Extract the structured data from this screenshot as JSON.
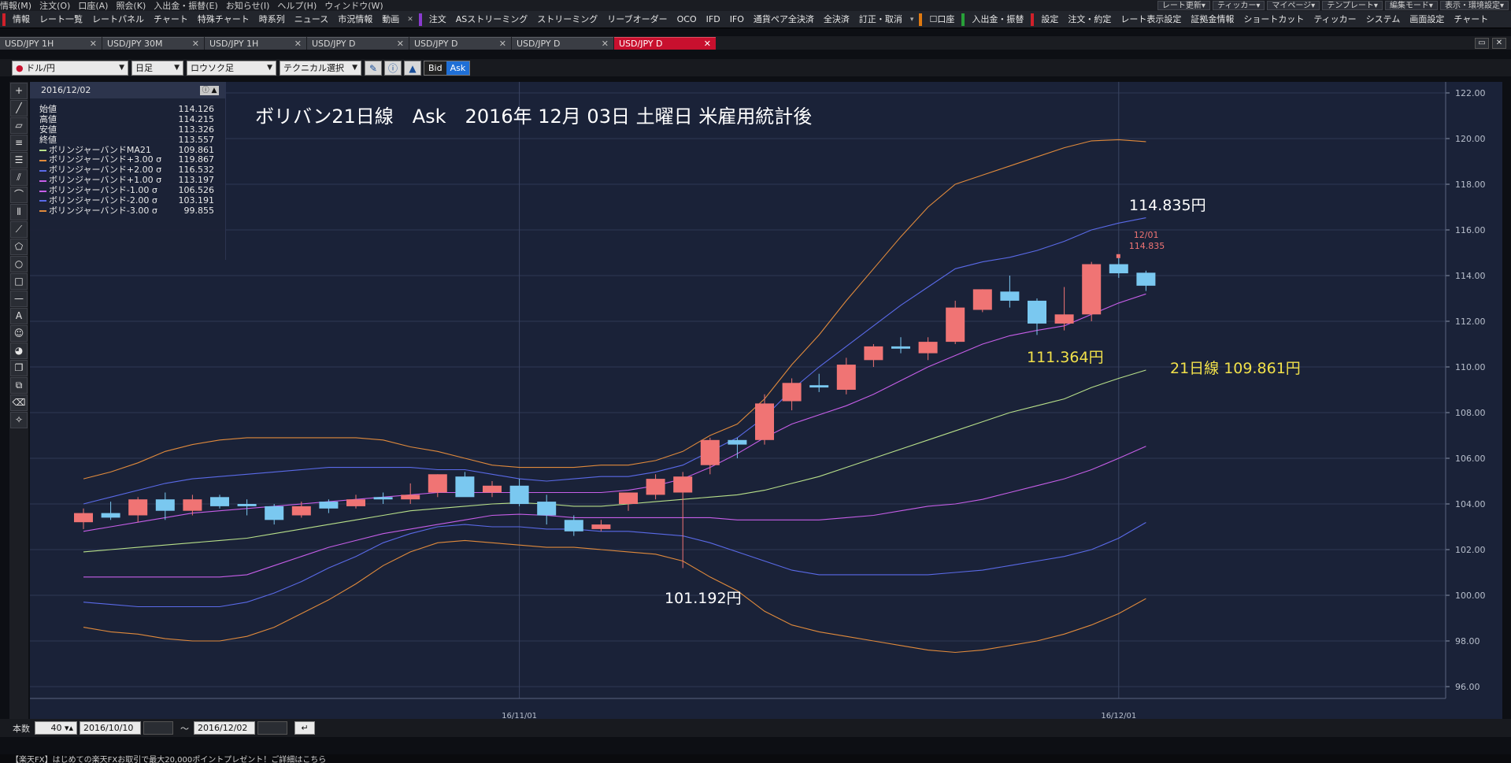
{
  "menubar": {
    "items": [
      "情報(M)",
      "注文(O)",
      "口座(A)",
      "照会(K)",
      "入出金・振替(E)",
      "お知らせ(I)",
      "ヘルプ(H)",
      "ウィンドウ(W)"
    ],
    "right_buttons": [
      "レート更新▾",
      "ティッカー▾",
      "マイページ▾",
      "テンプレート▾",
      "編集モード▾",
      "表示・環境設定▾"
    ]
  },
  "toolbar": {
    "info": "情報",
    "group1": [
      "レート一覧",
      "レートパネル",
      "チャート",
      "特殊チャート",
      "時系列",
      "ニュース",
      "市況情報",
      "動画"
    ],
    "order": "注文",
    "group2": [
      "ASストリーミング",
      "ストリーミング",
      "リーブオーダー",
      "OCO",
      "IFD",
      "IFO",
      "通貨ペア全決済",
      "全決済",
      "訂正・取消"
    ],
    "account": "口座",
    "transfer": "入出金・振替",
    "settings": "設定",
    "group3": [
      "注文・約定",
      "レート表示設定",
      "証拠金情報",
      "ショートカット",
      "ティッカー",
      "システム",
      "画面設定",
      "チャート"
    ],
    "colors": {
      "info": "#d0202a",
      "order": "#8a3bd0",
      "account": "#e07a10",
      "transfer": "#28a038",
      "settings": "#d0202a"
    }
  },
  "tabs": [
    {
      "label": "USD/JPY 1H",
      "active": false
    },
    {
      "label": "USD/JPY 30M",
      "active": false
    },
    {
      "label": "USD/JPY 1H",
      "active": false
    },
    {
      "label": "USD/JPY D",
      "active": false
    },
    {
      "label": "USD/JPY D",
      "active": false
    },
    {
      "label": "USD/JPY D",
      "active": false
    },
    {
      "label": "USD/JPY D",
      "active": true
    }
  ],
  "window_controls": {
    "maximize_icon": "maximize-icon",
    "close_icon": "close-icon"
  },
  "controls": {
    "pair": "ドル/円",
    "period": "日足",
    "chart_type": "ロウソク足",
    "technical": "テクニカル選択",
    "bid_label": "Bid",
    "ask_label": "Ask",
    "icons": [
      "flag-icon",
      "pencil-icon",
      "info-icon",
      "mountain-icon"
    ]
  },
  "draw_tools": [
    "crosshair-icon",
    "trendline-icon",
    "ruler-icon",
    "horizontal-lines-icon",
    "fibonacci-lines-icon",
    "channel-icon",
    "fan-icon",
    "cycle-lines-icon",
    "speed-lines-icon",
    "pentagon-icon",
    "circle-icon",
    "rectangle-icon",
    "hline-icon",
    "text-icon",
    "stamp-icon",
    "color-icon",
    "copy-icon",
    "lock-icon",
    "eraser-icon",
    "delete-all-icon"
  ],
  "ohlc_panel": {
    "date": "2016/12/02",
    "rows": [
      {
        "label": "始値",
        "value": "114.126"
      },
      {
        "label": "高値",
        "value": "114.215"
      },
      {
        "label": "安値",
        "value": "113.326"
      },
      {
        "label": "終値",
        "value": "113.557"
      }
    ],
    "bands": [
      {
        "label": "ボリンジャーバンドMA21",
        "value": "109.861",
        "color": "#b8e08a"
      },
      {
        "label": "ボリンジャーバンド+3.00 σ",
        "value": "119.867",
        "color": "#e08a3c"
      },
      {
        "label": "ボリンジャーバンド+2.00 σ",
        "value": "116.532",
        "color": "#5a6ae8"
      },
      {
        "label": "ボリンジャーバンド+1.00 σ",
        "value": "113.197",
        "color": "#c65ee8"
      },
      {
        "label": "ボリンジャーバンド-1.00 σ",
        "value": "106.526",
        "color": "#c65ee8"
      },
      {
        "label": "ボリンジャーバンド-2.00 σ",
        "value": "103.191",
        "color": "#5a6ae8"
      },
      {
        "label": "ボリンジャーバンド-3.00 σ",
        "value": "99.855",
        "color": "#e08a3c"
      }
    ]
  },
  "annotations": {
    "title": "ボリバン21日線　Ask　2016年 12月 03日 土曜日 米雇用統計後",
    "high_label": "114.835円",
    "plus1_label": "111.364円",
    "ma_label": "21日線  109.861円",
    "low_label": "101.192円",
    "marker_date": "12/01",
    "marker_value": "114.835"
  },
  "chart_data": {
    "type": "candlestick",
    "ylim": [
      95.0,
      122.7
    ],
    "yticks": [
      "96.00",
      "98.00",
      "100.00",
      "102.00",
      "104.00",
      "106.00",
      "108.00",
      "110.00",
      "112.00",
      "114.00",
      "116.00",
      "118.00",
      "120.00",
      "122.00"
    ],
    "xticks": [
      {
        "label": "16/11/01",
        "index": 16
      },
      {
        "label": "16/12/01",
        "index": 38
      }
    ],
    "colors": {
      "up": "#f07474",
      "down": "#7ac8f0",
      "ma": "#b8e08a",
      "s1": "#c65ee8",
      "s2": "#5a6ae8",
      "s3": "#e08a3c"
    },
    "candles": [
      {
        "o": 103.2,
        "h": 103.8,
        "l": 102.9,
        "c": 103.6
      },
      {
        "o": 103.6,
        "h": 104.1,
        "l": 103.3,
        "c": 103.4
      },
      {
        "o": 103.5,
        "h": 104.3,
        "l": 103.2,
        "c": 104.2
      },
      {
        "o": 104.2,
        "h": 104.5,
        "l": 103.3,
        "c": 103.7
      },
      {
        "o": 103.7,
        "h": 104.4,
        "l": 103.5,
        "c": 104.2
      },
      {
        "o": 104.3,
        "h": 104.4,
        "l": 103.8,
        "c": 103.9
      },
      {
        "o": 104.0,
        "h": 104.2,
        "l": 103.5,
        "c": 103.9
      },
      {
        "o": 103.9,
        "h": 104.0,
        "l": 103.1,
        "c": 103.3
      },
      {
        "o": 103.5,
        "h": 104.1,
        "l": 103.4,
        "c": 103.9
      },
      {
        "o": 104.1,
        "h": 104.2,
        "l": 103.6,
        "c": 103.8
      },
      {
        "o": 103.9,
        "h": 104.4,
        "l": 103.8,
        "c": 104.2
      },
      {
        "o": 104.3,
        "h": 104.5,
        "l": 104.0,
        "c": 104.2
      },
      {
        "o": 104.2,
        "h": 104.9,
        "l": 104.0,
        "c": 104.4
      },
      {
        "o": 104.5,
        "h": 105.3,
        "l": 104.3,
        "c": 105.3
      },
      {
        "o": 105.2,
        "h": 105.4,
        "l": 104.4,
        "c": 104.3
      },
      {
        "o": 104.5,
        "h": 105.0,
        "l": 104.3,
        "c": 104.8
      },
      {
        "o": 104.8,
        "h": 105.1,
        "l": 103.9,
        "c": 104.0
      },
      {
        "o": 104.1,
        "h": 104.4,
        "l": 103.1,
        "c": 103.5
      },
      {
        "o": 103.3,
        "h": 103.5,
        "l": 102.6,
        "c": 102.8
      },
      {
        "o": 102.9,
        "h": 103.3,
        "l": 102.8,
        "c": 103.1
      },
      {
        "o": 104.0,
        "h": 104.5,
        "l": 103.7,
        "c": 104.5
      },
      {
        "o": 104.4,
        "h": 105.3,
        "l": 104.2,
        "c": 105.1
      },
      {
        "o": 104.5,
        "h": 105.4,
        "l": 101.192,
        "c": 105.2
      },
      {
        "o": 105.7,
        "h": 106.9,
        "l": 105.3,
        "c": 106.8
      },
      {
        "o": 106.8,
        "h": 106.9,
        "l": 106.0,
        "c": 106.6
      },
      {
        "o": 106.8,
        "h": 108.8,
        "l": 106.6,
        "c": 108.4
      },
      {
        "o": 108.5,
        "h": 109.5,
        "l": 108.1,
        "c": 109.3
      },
      {
        "o": 109.2,
        "h": 109.7,
        "l": 108.9,
        "c": 109.1
      },
      {
        "o": 109.0,
        "h": 110.4,
        "l": 108.8,
        "c": 110.1
      },
      {
        "o": 110.3,
        "h": 111.0,
        "l": 110.0,
        "c": 110.9
      },
      {
        "o": 110.9,
        "h": 111.3,
        "l": 110.6,
        "c": 110.8
      },
      {
        "o": 110.6,
        "h": 111.3,
        "l": 110.3,
        "c": 111.1
      },
      {
        "o": 111.1,
        "h": 112.9,
        "l": 111.0,
        "c": 112.6
      },
      {
        "o": 112.5,
        "h": 113.4,
        "l": 112.4,
        "c": 113.4
      },
      {
        "o": 113.3,
        "h": 114.0,
        "l": 112.6,
        "c": 112.9
      },
      {
        "o": 112.9,
        "h": 113.0,
        "l": 111.4,
        "c": 111.9
      },
      {
        "o": 111.9,
        "h": 113.5,
        "l": 111.6,
        "c": 112.3
      },
      {
        "o": 112.3,
        "h": 114.6,
        "l": 112.0,
        "c": 114.5
      },
      {
        "o": 114.5,
        "h": 114.835,
        "l": 113.9,
        "c": 114.1
      },
      {
        "o": 114.126,
        "h": 114.215,
        "l": 113.326,
        "c": 113.557
      }
    ],
    "ma21": [
      101.9,
      102.0,
      102.1,
      102.2,
      102.3,
      102.4,
      102.5,
      102.7,
      102.9,
      103.1,
      103.3,
      103.5,
      103.7,
      103.8,
      103.9,
      104.0,
      104.05,
      104.0,
      103.9,
      103.9,
      104.0,
      104.1,
      104.2,
      104.3,
      104.4,
      104.6,
      104.9,
      105.2,
      105.6,
      106.0,
      106.4,
      106.8,
      107.2,
      107.6,
      108.0,
      108.3,
      108.6,
      109.1,
      109.5,
      109.861
    ],
    "plus1": [
      102.8,
      103.0,
      103.2,
      103.4,
      103.6,
      103.7,
      103.8,
      103.9,
      104.0,
      104.1,
      104.2,
      104.3,
      104.4,
      104.5,
      104.5,
      104.5,
      104.5,
      104.5,
      104.5,
      104.5,
      104.6,
      104.8,
      105.1,
      105.6,
      106.2,
      106.9,
      107.5,
      107.9,
      108.3,
      108.8,
      109.4,
      110.0,
      110.5,
      111.0,
      111.364,
      111.6,
      111.8,
      112.3,
      112.8,
      113.197
    ],
    "plus2": [
      104.0,
      104.3,
      104.6,
      104.9,
      105.1,
      105.2,
      105.3,
      105.4,
      105.5,
      105.6,
      105.6,
      105.6,
      105.6,
      105.5,
      105.5,
      105.3,
      105.1,
      105.0,
      105.1,
      105.2,
      105.2,
      105.4,
      105.7,
      106.3,
      106.9,
      107.8,
      109.0,
      110.0,
      110.9,
      111.8,
      112.7,
      113.5,
      114.3,
      114.6,
      114.8,
      115.1,
      115.5,
      116.0,
      116.3,
      116.532
    ],
    "plus3": [
      105.1,
      105.4,
      105.8,
      106.3,
      106.6,
      106.8,
      106.9,
      106.9,
      106.9,
      106.9,
      106.9,
      106.8,
      106.5,
      106.3,
      106.0,
      105.7,
      105.6,
      105.6,
      105.6,
      105.7,
      105.7,
      105.9,
      106.3,
      107.0,
      107.5,
      108.6,
      110.1,
      111.4,
      112.9,
      114.3,
      115.7,
      117.0,
      118.0,
      118.4,
      118.8,
      119.2,
      119.6,
      119.9,
      119.95,
      119.867
    ],
    "minus1": [
      100.8,
      100.8,
      100.8,
      100.8,
      100.8,
      100.8,
      100.9,
      101.3,
      101.7,
      102.1,
      102.4,
      102.7,
      102.9,
      103.1,
      103.3,
      103.5,
      103.55,
      103.5,
      103.4,
      103.4,
      103.4,
      103.4,
      103.4,
      103.4,
      103.3,
      103.3,
      103.3,
      103.3,
      103.4,
      103.5,
      103.7,
      103.9,
      104.0,
      104.2,
      104.5,
      104.8,
      105.1,
      105.5,
      106.0,
      106.526
    ],
    "minus2": [
      99.7,
      99.6,
      99.5,
      99.5,
      99.5,
      99.5,
      99.7,
      100.1,
      100.6,
      101.2,
      101.7,
      102.3,
      102.7,
      103.0,
      103.1,
      103.0,
      103.0,
      102.9,
      102.9,
      102.8,
      102.8,
      102.7,
      102.6,
      102.3,
      101.9,
      101.5,
      101.1,
      100.9,
      100.9,
      100.9,
      100.9,
      100.9,
      101.0,
      101.1,
      101.3,
      101.5,
      101.7,
      102.0,
      102.5,
      103.191
    ],
    "minus3": [
      98.6,
      98.4,
      98.3,
      98.1,
      98.0,
      98.0,
      98.2,
      98.6,
      99.2,
      99.8,
      100.5,
      101.3,
      101.9,
      102.3,
      102.4,
      102.3,
      102.2,
      102.1,
      102.1,
      102.0,
      101.9,
      101.8,
      101.5,
      100.8,
      100.2,
      99.3,
      98.7,
      98.4,
      98.2,
      98.0,
      97.8,
      97.6,
      97.5,
      97.6,
      97.8,
      98.0,
      98.3,
      98.7,
      99.2,
      99.855
    ]
  },
  "bottom": {
    "count_label": "本数",
    "count_value": "40",
    "from_date": "2016/10/10",
    "tilde": "〜",
    "to_date": "2016/12/02",
    "refresh_icon": "return-icon"
  },
  "status": {
    "text": "【楽天FX】はじめての楽天FXお取引で最大20,000ポイントプレゼント！ご詳細はこちら"
  }
}
